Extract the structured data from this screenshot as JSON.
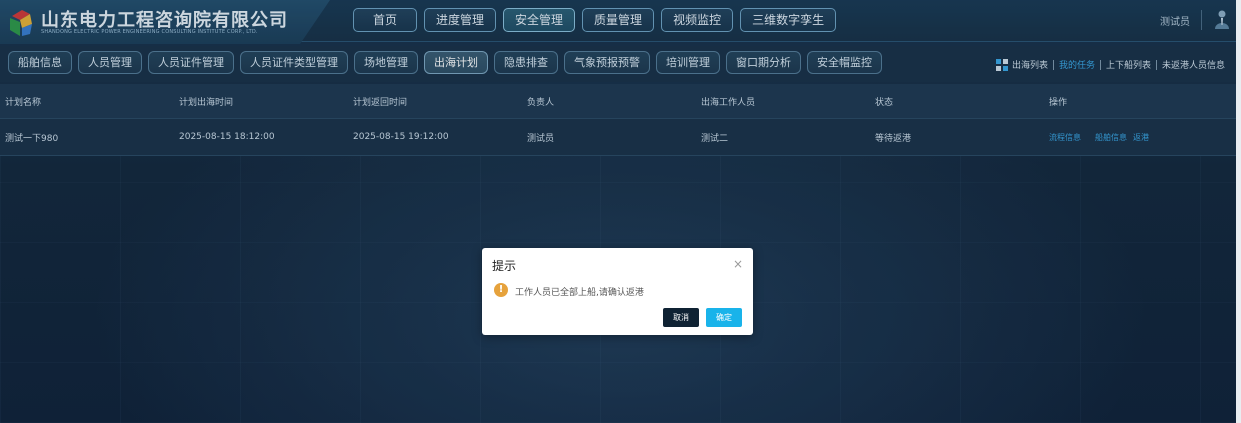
{
  "header": {
    "company_name": "山东电力工程咨询院有限公司",
    "company_sub": "SHANDONG ELECTRIC POWER ENGINEERING CONSULTING INSTITUTE CORP., LTD.",
    "nav": [
      {
        "label": "首页",
        "active": false
      },
      {
        "label": "进度管理",
        "active": false
      },
      {
        "label": "安全管理",
        "active": true
      },
      {
        "label": "质量管理",
        "active": false
      },
      {
        "label": "视频监控",
        "active": false
      },
      {
        "label": "三维数字孪生",
        "active": false
      }
    ],
    "user": "测试员"
  },
  "subnav": {
    "tabs": [
      {
        "label": "船舶信息",
        "active": false
      },
      {
        "label": "人员管理",
        "active": false
      },
      {
        "label": "人员证件管理",
        "active": false
      },
      {
        "label": "人员证件类型管理",
        "active": false
      },
      {
        "label": "场地管理",
        "active": false
      },
      {
        "label": "出海计划",
        "active": true
      },
      {
        "label": "隐患排查",
        "active": false
      },
      {
        "label": "气象预报预警",
        "active": false
      },
      {
        "label": "培训管理",
        "active": false
      },
      {
        "label": "窗口期分析",
        "active": false
      },
      {
        "label": "安全帽监控",
        "active": false
      }
    ],
    "right_links": [
      {
        "label": "出海列表",
        "highlight": false
      },
      {
        "label": "我的任务",
        "highlight": true
      },
      {
        "label": "上下船列表",
        "highlight": false
      },
      {
        "label": "未返港人员信息",
        "highlight": false
      }
    ]
  },
  "table": {
    "headers": [
      "计划名称",
      "计划出海时间",
      "计划返回时间",
      "负责人",
      "出海工作人员",
      "状态",
      "操作"
    ],
    "rows": [
      {
        "name": "测试一下980",
        "depart_time": "2025-08-15 18:12:00",
        "return_time": "2025-08-15 19:12:00",
        "leader": "测试员",
        "workers": "测试二",
        "status": "等待返港",
        "actions": [
          "流程信息",
          "船舶信息",
          "返港"
        ]
      }
    ]
  },
  "dialog": {
    "title": "提示",
    "close": "×",
    "icon": "warning-icon",
    "message": "工作人员已全部上船,请确认返港",
    "cancel": "取消",
    "confirm": "确定"
  },
  "colors": {
    "accent": "#3aa8e6",
    "confirm": "#19b3ea",
    "warning": "#e6a23c",
    "background": "#13263a"
  }
}
